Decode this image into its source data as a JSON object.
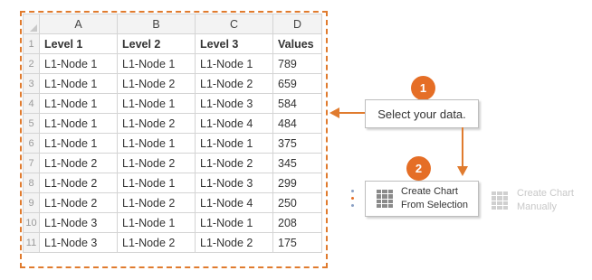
{
  "spreadsheet": {
    "columns": [
      "A",
      "B",
      "C",
      "D"
    ],
    "rows": [
      {
        "num": "1",
        "cells": [
          "Level 1",
          "Level 2",
          "Level 3",
          "Values"
        ]
      },
      {
        "num": "2",
        "cells": [
          "L1-Node 1",
          "L1-Node 1",
          "L1-Node 1",
          "789"
        ]
      },
      {
        "num": "3",
        "cells": [
          "L1-Node 1",
          "L1-Node 2",
          "L1-Node 2",
          "659"
        ]
      },
      {
        "num": "4",
        "cells": [
          "L1-Node 1",
          "L1-Node 1",
          "L1-Node 3",
          "584"
        ]
      },
      {
        "num": "5",
        "cells": [
          "L1-Node 1",
          "L1-Node 2",
          "L1-Node 4",
          "484"
        ]
      },
      {
        "num": "6",
        "cells": [
          "L1-Node 1",
          "L1-Node 1",
          "L1-Node 1",
          "375"
        ]
      },
      {
        "num": "7",
        "cells": [
          "L1-Node 2",
          "L1-Node 2",
          "L1-Node 2",
          "345"
        ]
      },
      {
        "num": "8",
        "cells": [
          "L1-Node 2",
          "L1-Node 1",
          "L1-Node 3",
          "299"
        ]
      },
      {
        "num": "9",
        "cells": [
          "L1-Node 2",
          "L1-Node 2",
          "L1-Node 4",
          "250"
        ]
      },
      {
        "num": "10",
        "cells": [
          "L1-Node 3",
          "L1-Node 1",
          "L1-Node 1",
          "208"
        ]
      },
      {
        "num": "11",
        "cells": [
          "L1-Node 3",
          "L1-Node 2",
          "L1-Node 2",
          "175"
        ]
      }
    ]
  },
  "steps": {
    "step1": {
      "badge": "1",
      "text": "Select your data."
    },
    "step2": {
      "badge": "2"
    }
  },
  "buttons": {
    "create_from_selection": {
      "line1": "Create Chart",
      "line2": "From Selection",
      "icon": "table-icon"
    },
    "create_manually": {
      "line1": "Create Chart",
      "line2": "Manually",
      "icon": "table-icon"
    }
  },
  "colors": {
    "accent": "#e56e26",
    "selection_border": "#e07b2e",
    "header_bg": "#f3f3f3",
    "grid_border": "#d4d4d4"
  }
}
